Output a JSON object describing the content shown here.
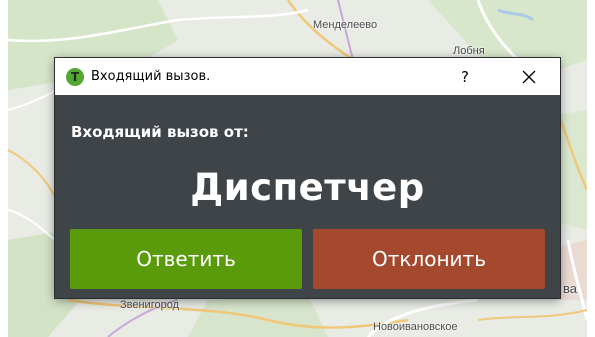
{
  "map": {
    "labels": [
      "Менделеево",
      "Лобня",
      "Звенигород",
      "Новоивановское",
      "ва"
    ]
  },
  "dialog": {
    "title": "Входящий вызов.",
    "app_icon_letter": "T",
    "help_label": "?",
    "caller_caption": "Входящий вызов от:",
    "caller_name": "Диспетчер",
    "answer_label": "Ответить",
    "decline_label": "Отклонить"
  },
  "colors": {
    "dialog_bg": "#3f4449",
    "answer_button": "#5a9b0b",
    "decline_button": "#a4482e",
    "app_icon": "#54a832"
  },
  "icons": {
    "app": "taxi-app-icon",
    "close": "close-icon"
  }
}
